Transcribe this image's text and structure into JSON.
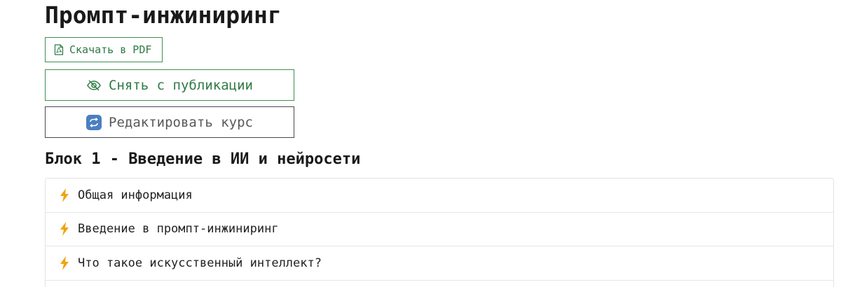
{
  "page": {
    "title": "Промпт-инжиниринг"
  },
  "actions": {
    "download_pdf": {
      "label": "Скачать в PDF",
      "icon": "pdf-file-icon"
    },
    "unpublish": {
      "label": "Снять с публикации",
      "icon": "eye-slash-icon"
    },
    "edit_course": {
      "label": "Редактировать курс",
      "icon": "edit-course-icon"
    }
  },
  "block": {
    "title": "Блок 1 - Введение в ИИ и нейросети",
    "lessons": [
      {
        "label": "Общая информация",
        "icon": "lightning-icon"
      },
      {
        "label": "Введение в промпт-инжиниринг",
        "icon": "lightning-icon"
      },
      {
        "label": "Что такое искусственный интеллект?",
        "icon": "lightning-icon"
      }
    ]
  },
  "colors": {
    "accent_green": "#2f7a45",
    "border_green": "#3f8f53",
    "bolt_orange": "#f2a20c",
    "edit_icon_blue": "#4a7fc1"
  }
}
